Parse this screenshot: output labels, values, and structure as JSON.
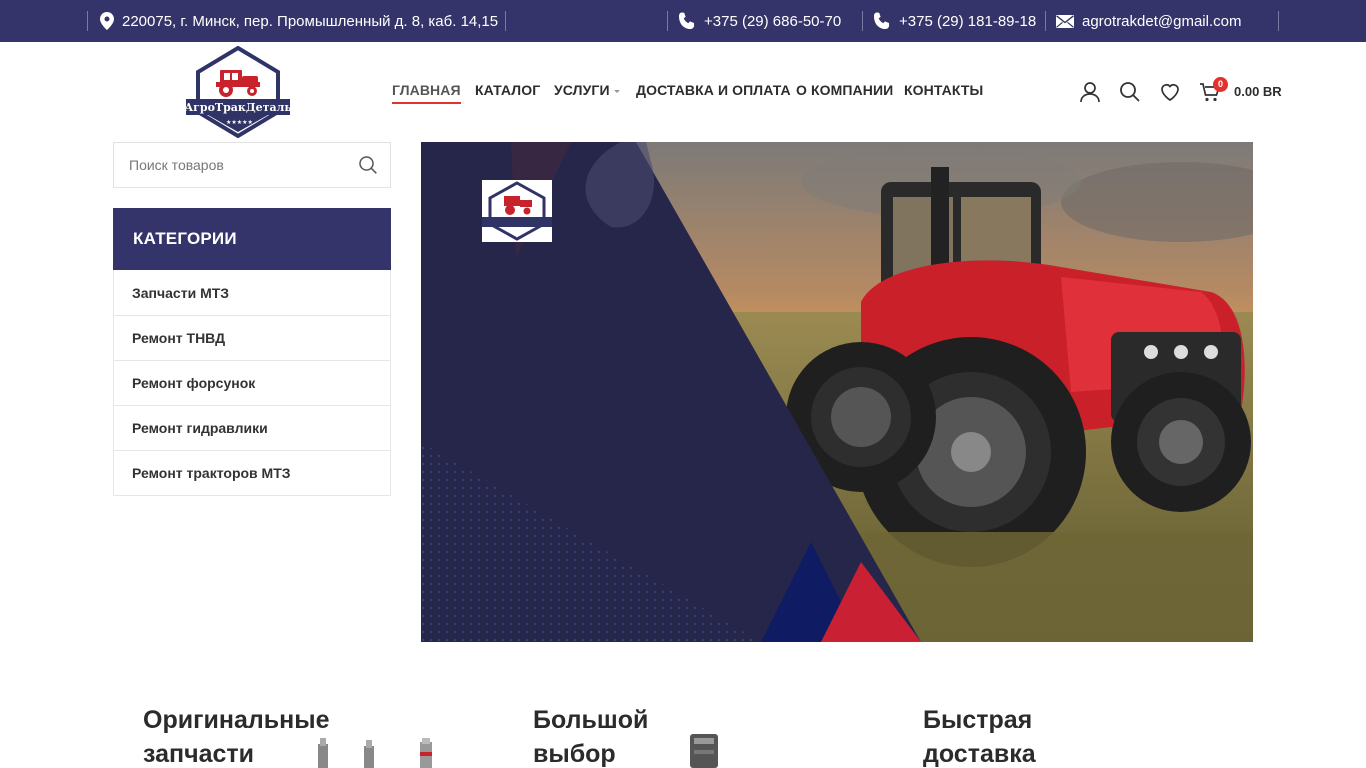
{
  "topbar": {
    "address": "220075, г. Минск, пер. Промышленный д. 8, каб. 14,15",
    "phone1": "+375 (29) 686-50-70",
    "phone2": "+375 (29) 181-89-18",
    "email": "agrotrakdet@gmail.com"
  },
  "logo": {
    "text": "АгроТракДеталь"
  },
  "nav": {
    "items": [
      {
        "label": "ГЛАВНАЯ"
      },
      {
        "label": "КАТАЛОГ"
      },
      {
        "label": "УСЛУГИ"
      },
      {
        "label": "ДОСТАВКА И ОПЛАТА"
      },
      {
        "label": "О КОМПАНИИ"
      },
      {
        "label": "КОНТАКТЫ"
      }
    ]
  },
  "header_tools": {
    "cart_count": "0",
    "cart_total": "0.00 BR"
  },
  "search": {
    "placeholder": "Поиск товаров"
  },
  "categories": {
    "title": "КАТЕГОРИИ",
    "items": [
      {
        "label": "Запчасти МТЗ"
      },
      {
        "label": "Ремонт ТНВД"
      },
      {
        "label": "Ремонт форсунок"
      },
      {
        "label": "Ремонт гидравлики"
      },
      {
        "label": "Ремонт тракторов МТЗ"
      }
    ]
  },
  "features": [
    {
      "line1": "Оригинальные",
      "line2": "запчасти"
    },
    {
      "line1": "Большой",
      "line2": "выбор"
    },
    {
      "line1": "Быстрая",
      "line2": "доставка"
    }
  ],
  "colors": {
    "brand_navy": "#35346a",
    "accent_red": "#e0322f"
  }
}
